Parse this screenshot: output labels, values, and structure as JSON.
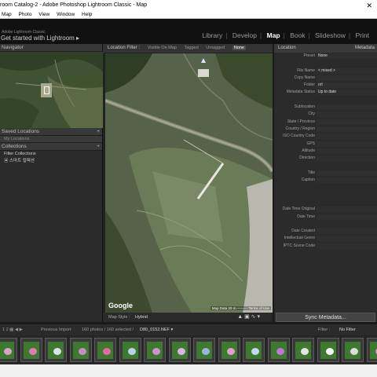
{
  "window": {
    "title": "room Catalog-2 - Adobe Photoshop Lightroom Classic - Map",
    "close_glyph": "✕"
  },
  "menu": [
    "Map",
    "Photo",
    "View",
    "Window",
    "Help"
  ],
  "identity": {
    "subtitle": "Adobe Lightroom Classic",
    "title": "Get started with Lightroom ▸"
  },
  "modules": {
    "items": [
      "Library",
      "Develop",
      "Map",
      "Book",
      "Slideshow",
      "Print"
    ],
    "active": "Map",
    "separator": "|"
  },
  "left_panel": {
    "navigator": "Navigator",
    "saved_locations": "Saved Locations",
    "plus": "+",
    "my_locations": "My Locations",
    "collections": "Collections",
    "filter_collections": "Filter Collections",
    "collection_item": "스마트 컬렉션"
  },
  "filter_bar": {
    "title": "Location Filter :",
    "options": [
      "Visible On Map",
      "Tagged",
      "Untagged",
      "None"
    ],
    "selected": "None"
  },
  "map": {
    "google": "Google",
    "attribution": "Map Data  20 m ———  Terms of Use",
    "style_label": "Map Style :",
    "style_value": "Hybrid",
    "icons": "▲ ▣ ∿ ▾"
  },
  "metadata": {
    "header_left": "Location",
    "header_right": "Metadata",
    "rows": [
      {
        "label": "Preset",
        "value": "None"
      },
      {
        "label": "",
        "value": ""
      },
      {
        "label": "File Name",
        "value": "< mixed >"
      },
      {
        "label": "Copy Name",
        "value": ""
      },
      {
        "label": "Folder",
        "value": "orl"
      },
      {
        "label": "Metadata Status",
        "value": "Up to date"
      },
      {
        "label": "",
        "value": ""
      },
      {
        "label": "Sublocation",
        "value": ""
      },
      {
        "label": "City",
        "value": ""
      },
      {
        "label": "State / Province",
        "value": ""
      },
      {
        "label": "Country / Region",
        "value": ""
      },
      {
        "label": "ISO Country Code",
        "value": ""
      },
      {
        "label": "GPS",
        "value": ""
      },
      {
        "label": "Altitude",
        "value": ""
      },
      {
        "label": "Direction",
        "value": ""
      },
      {
        "label": "",
        "value": ""
      },
      {
        "label": "Title",
        "value": ""
      },
      {
        "label": "Caption",
        "value": ""
      },
      {
        "label": "",
        "value": ""
      },
      {
        "label": "",
        "value": ""
      },
      {
        "label": "",
        "value": ""
      },
      {
        "label": "Date Time Original",
        "value": ""
      },
      {
        "label": "Date Time",
        "value": ""
      },
      {
        "label": "",
        "value": ""
      },
      {
        "label": "Date Created",
        "value": ""
      },
      {
        "label": "Intellectual Genre",
        "value": ""
      },
      {
        "label": "IPTC Scene Code",
        "value": ""
      }
    ],
    "sync_button": "Sync Metadata..."
  },
  "filmstrip_bar": {
    "nav_icons": "1  2  ▦  ◀  ▶",
    "source": "Previous Import",
    "count": "160 photos / 160 selected /",
    "file": "D80_0152.NEF ▾",
    "filter_label": "Filter :",
    "filter_value": "No Filter"
  },
  "thumbnails": [
    {
      "flower": "#d9a3c4"
    },
    {
      "flower": "#e07ab0"
    },
    {
      "flower": "#dfe0e8"
    },
    {
      "flower": "#c98bc0"
    },
    {
      "flower": "#e26aa8"
    },
    {
      "flower": "#b9d2e8"
    },
    {
      "flower": "#d58fd0"
    },
    {
      "flower": "#d7b6e0"
    },
    {
      "flower": "#9fb3e0"
    },
    {
      "flower": "#e3a0cf"
    },
    {
      "flower": "#c6d9f0"
    },
    {
      "flower": "#c078d4"
    },
    {
      "flower": "#e4e4e4"
    },
    {
      "flower": "#f2f2f2"
    },
    {
      "flower": "#dcdcdc"
    },
    {
      "flower": "#e08ac4"
    }
  ]
}
